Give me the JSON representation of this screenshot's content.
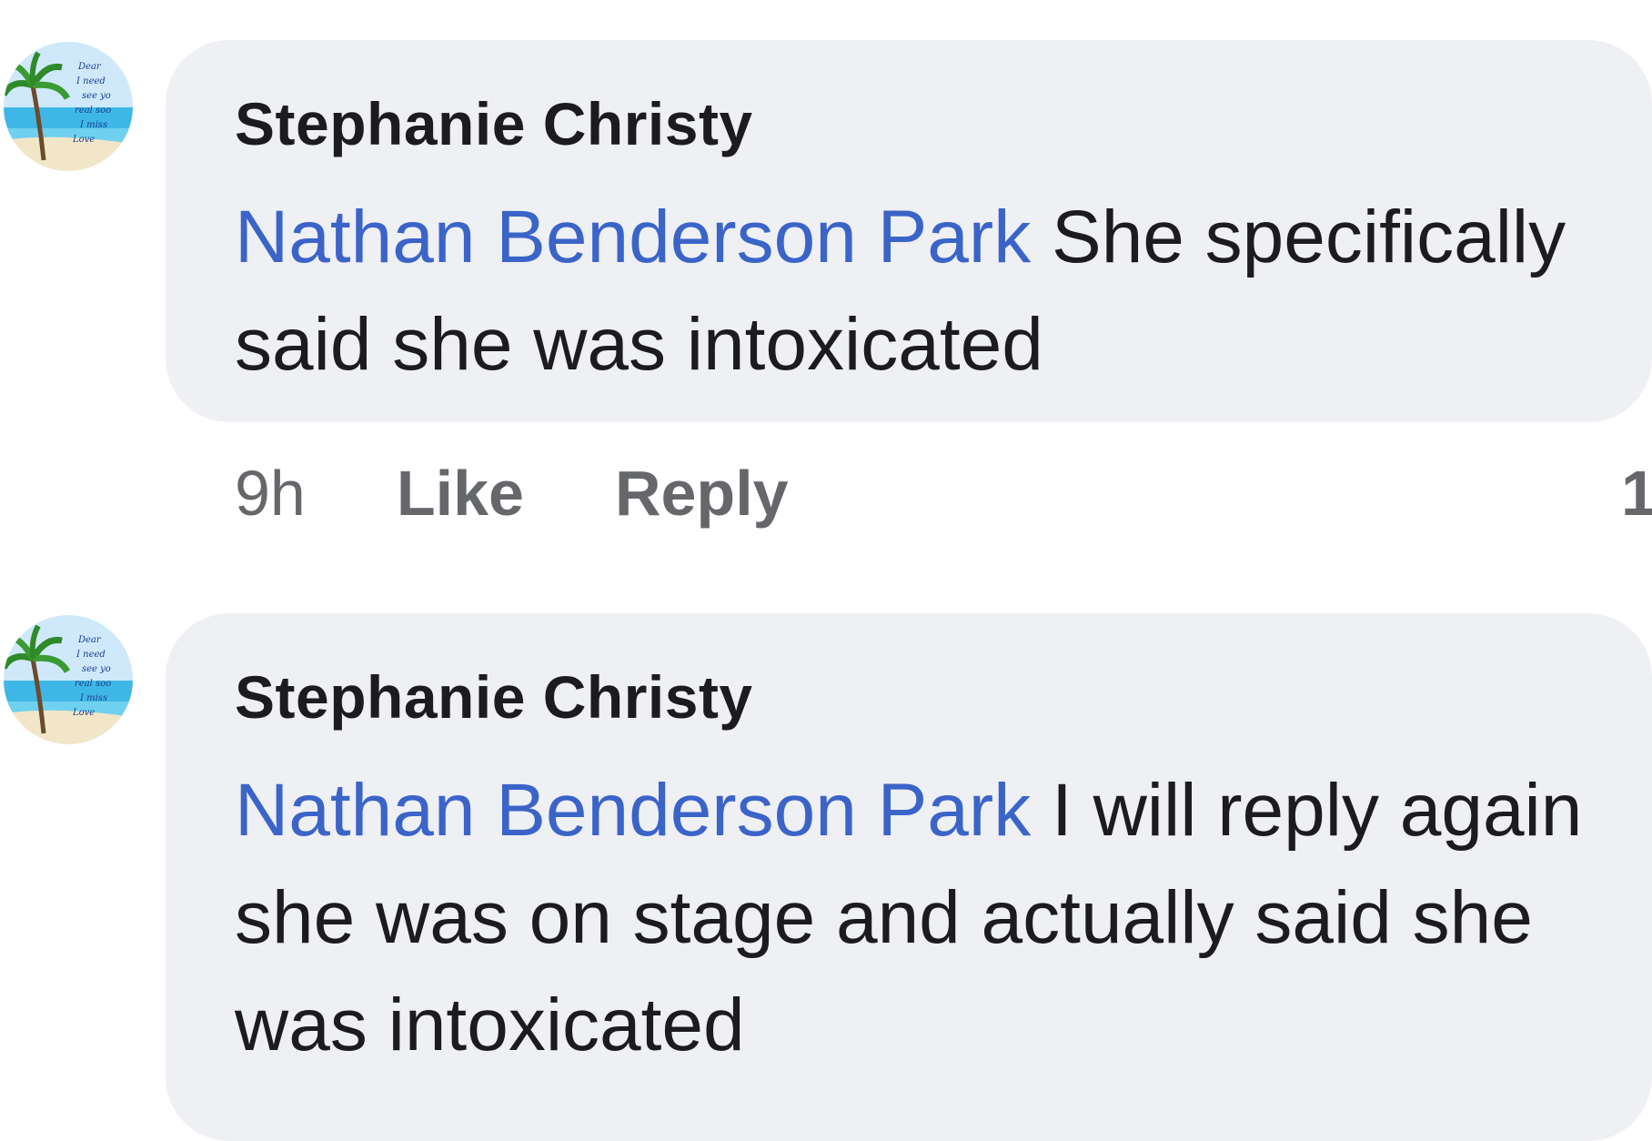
{
  "comments": [
    {
      "author": "Stephanie Christy",
      "mention": "Nathan Benderson Park",
      "text": " She specifically said she was intoxicated",
      "time": "9h",
      "like_label": "Like",
      "reply_label": "Reply",
      "reaction_count": "1",
      "avatar_icon": "palm-beach-avatar",
      "avatar_text": [
        "Dear",
        "I need",
        "see yo",
        "real soo",
        "I miss",
        "Love"
      ]
    },
    {
      "author": "Stephanie Christy",
      "mention": "Nathan Benderson Park",
      "text": " I will reply again she was on stage and actually said she was intoxicated",
      "avatar_icon": "palm-beach-avatar",
      "avatar_text": [
        "Dear",
        "I need",
        "see yo",
        "real soo",
        "I miss",
        "Love"
      ]
    }
  ],
  "colors": {
    "bubble": "#eff0f4",
    "mention": "#3b64c9",
    "text": "#1c1c1e",
    "meta": "#65676b"
  }
}
